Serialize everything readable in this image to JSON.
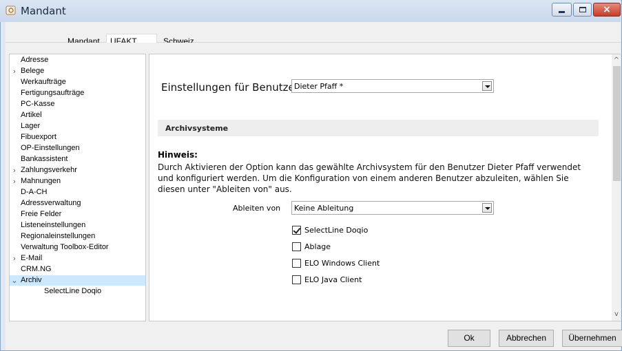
{
  "window": {
    "title": "Mandant",
    "minimize": "",
    "maximize": "",
    "close": "×"
  },
  "header": {
    "mandant_label": "Mandant",
    "mandant_value": "UFAKT",
    "country": "Schweiz"
  },
  "sidebar": {
    "items": [
      {
        "label": "Adresse",
        "expandable": false
      },
      {
        "label": "Belege",
        "expandable": true
      },
      {
        "label": "Werkaufträge",
        "expandable": false
      },
      {
        "label": "Fertigungsaufträge",
        "expandable": false
      },
      {
        "label": "PC-Kasse",
        "expandable": false
      },
      {
        "label": "Artikel",
        "expandable": false
      },
      {
        "label": "Lager",
        "expandable": false
      },
      {
        "label": "Fibuexport",
        "expandable": false
      },
      {
        "label": "OP-Einstellungen",
        "expandable": false
      },
      {
        "label": "Bankassistent",
        "expandable": false
      },
      {
        "label": "Zahlungsverkehr",
        "expandable": true
      },
      {
        "label": "Mahnungen",
        "expandable": true
      },
      {
        "label": "D-A-CH",
        "expandable": false
      },
      {
        "label": "Adressverwaltung",
        "expandable": false
      },
      {
        "label": "Freie Felder",
        "expandable": false
      },
      {
        "label": "Listeneinstellungen",
        "expandable": false
      },
      {
        "label": "Regionaleinstellungen",
        "expandable": false
      },
      {
        "label": "Verwaltung Toolbox-Editor",
        "expandable": false
      },
      {
        "label": "E-Mail",
        "expandable": true
      },
      {
        "label": "CRM.NG",
        "expandable": false
      },
      {
        "label": "Archiv",
        "expandable": true,
        "expanded": true,
        "selected": true
      },
      {
        "label": "SelectLine Doqio",
        "child": true
      }
    ]
  },
  "main": {
    "settings_for_user_label": "Einstellungen für Benutzer",
    "user_select_value": "Dieter Pfaff *",
    "section_title": "Archivsysteme",
    "hint_title": "Hinweis:",
    "hint_text": "Durch Aktivieren der Option kann das gewählte Archivsystem für den Benutzer Dieter Pfaff verwendet und konfiguriert werden. Um die Konfiguration von einem anderen Benutzer abzuleiten, wählen Sie diesen unter \"Ableiten von\" aus.",
    "derive_label": "Ableiten von",
    "derive_value": "Keine Ableitung",
    "archives": [
      {
        "label": "SelectLine Doqio",
        "checked": true
      },
      {
        "label": "Ablage",
        "checked": false
      },
      {
        "label": "ELO Windows Client",
        "checked": false
      },
      {
        "label": "ELO Java Client",
        "checked": false
      }
    ]
  },
  "footer": {
    "ok_label": "Ok",
    "cancel_label": "Abbrechen",
    "apply_label": "Übernehmen"
  },
  "scroll": {
    "up": "^",
    "down": "v"
  }
}
